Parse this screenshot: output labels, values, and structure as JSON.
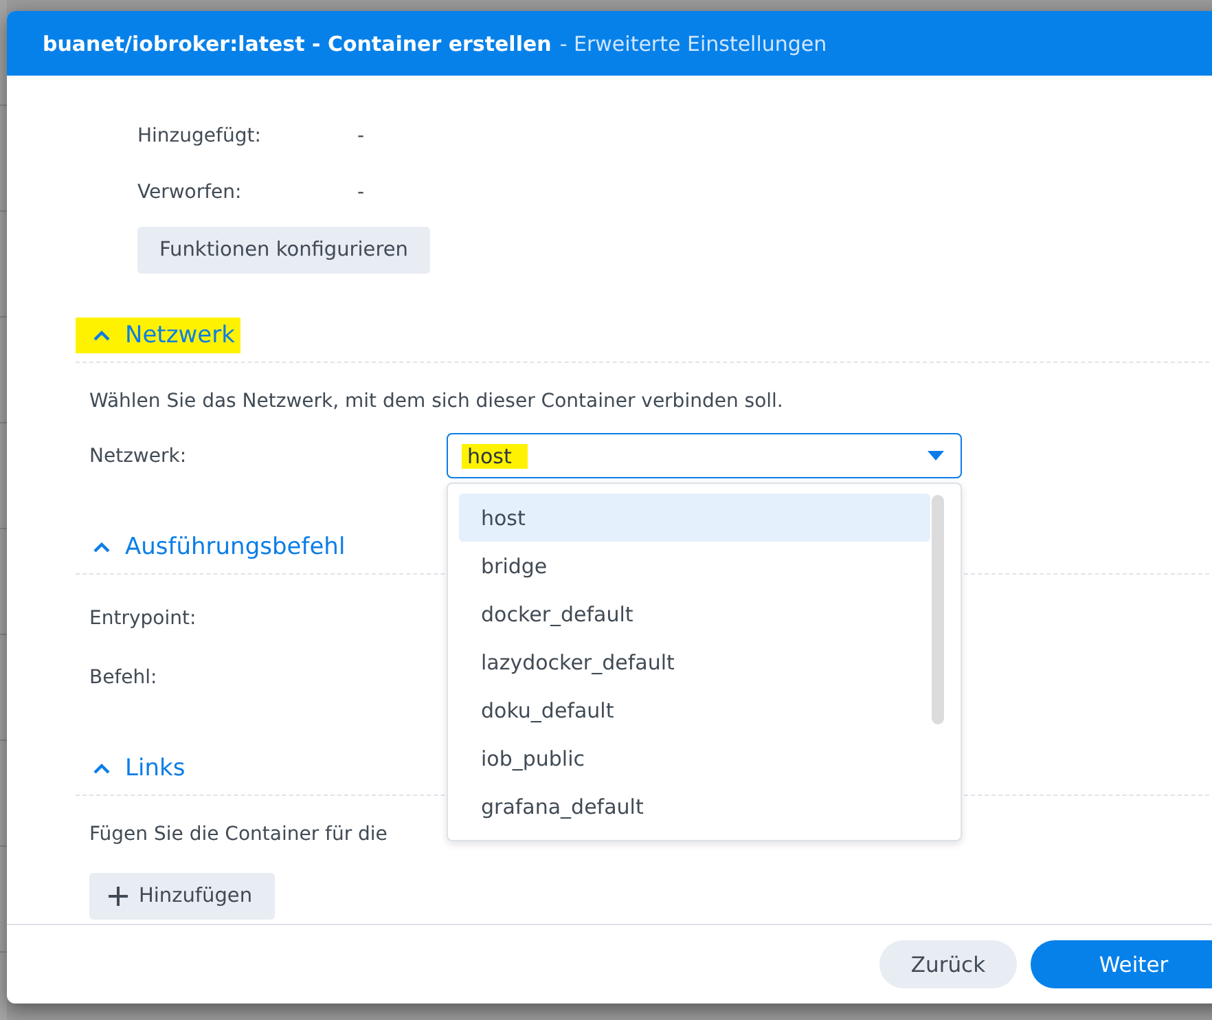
{
  "dialog": {
    "title": "buanet/iobroker:latest - Container erstellen",
    "subtitle": "- Erweiterte Einstellungen"
  },
  "capabilities": {
    "rows": [
      {
        "label": "Hinzugefügt:",
        "value": "-"
      },
      {
        "label": "Verworfen:",
        "value": "-"
      }
    ],
    "button": "Funktionen konfigurieren"
  },
  "network_section": {
    "title": "Netzwerk",
    "expanded": true,
    "highlighted": true,
    "description": "Wählen Sie das Netzwerk, mit dem sich dieser Container verbinden soll.",
    "field_label": "Netzwerk:",
    "select": {
      "value": "host",
      "highlighted": true,
      "open": true,
      "options": [
        {
          "label": "host",
          "selected": true
        },
        {
          "label": "bridge",
          "selected": false
        },
        {
          "label": "docker_default",
          "selected": false
        },
        {
          "label": "lazydocker_default",
          "selected": false
        },
        {
          "label": "doku_default",
          "selected": false
        },
        {
          "label": "iob_public",
          "selected": false
        },
        {
          "label": "grafana_default",
          "selected": false
        }
      ]
    }
  },
  "command_section": {
    "title": "Ausführungsbefehl",
    "expanded": true,
    "highlighted": false,
    "fields": [
      {
        "label": "Entrypoint:"
      },
      {
        "label": "Befehl:"
      }
    ]
  },
  "links_section": {
    "title": "Links",
    "expanded": true,
    "highlighted": false,
    "description": "Fügen Sie die Container für die",
    "add_button": "Hinzufügen"
  },
  "footer": {
    "buttons": [
      {
        "label": "Zurück",
        "kind": "secondary"
      },
      {
        "label": "Weiter",
        "kind": "primary"
      }
    ]
  }
}
